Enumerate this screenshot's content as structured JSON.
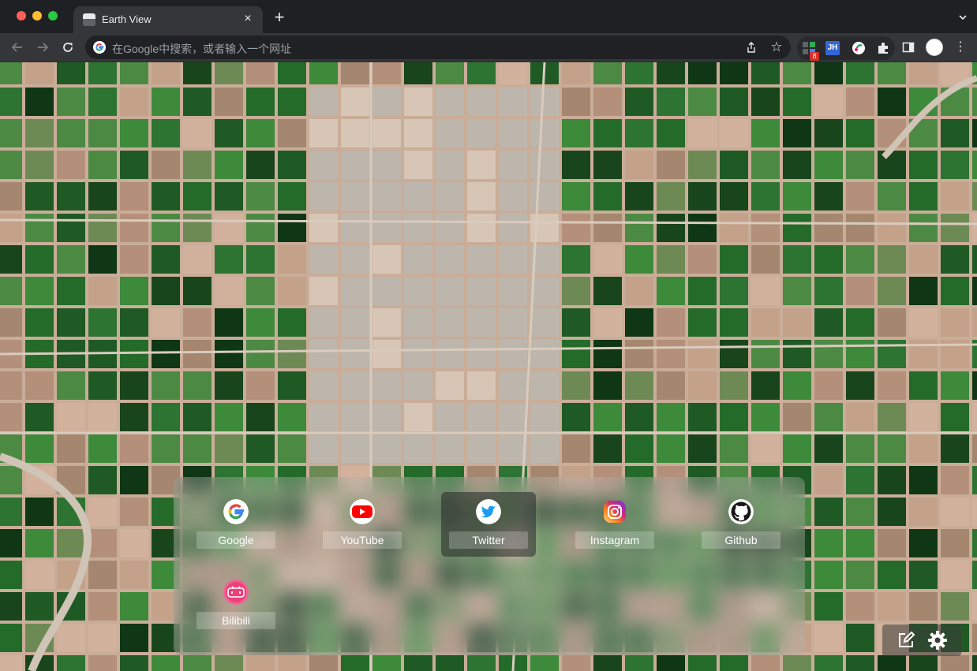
{
  "browser": {
    "tab": {
      "title": "Earth View",
      "close_glyph": "×"
    },
    "new_tab_glyph": "+",
    "omnibox": {
      "placeholder": "在Google中搜索，或者输入一个网址"
    },
    "extensions": [
      {
        "name": "extension-grid-icon",
        "badge": "8"
      },
      {
        "name": "jh-extension-icon",
        "label": "JH"
      },
      {
        "name": "green-link-extension-icon"
      },
      {
        "name": "puzzle-extensions-icon"
      }
    ],
    "star_glyph": "☆",
    "menu_glyph": "⋮"
  },
  "shortcuts": [
    {
      "label": "Google",
      "icon": "google-icon"
    },
    {
      "label": "YouTube",
      "icon": "youtube-icon"
    },
    {
      "label": "Twitter",
      "icon": "twitter-icon"
    },
    {
      "label": "Instagram",
      "icon": "instagram-icon"
    },
    {
      "label": "Github",
      "icon": "github-icon"
    },
    {
      "label": "Bilibili",
      "icon": "bilibili-icon"
    }
  ],
  "colors": {
    "chrome_dark": "#1f2023",
    "toolbar": "#35363a",
    "field_green_dark": "#1d4d22",
    "field_green": "#2f7a35",
    "field_tan": "#c9a78e",
    "city_grey": "#b9b3ab"
  }
}
